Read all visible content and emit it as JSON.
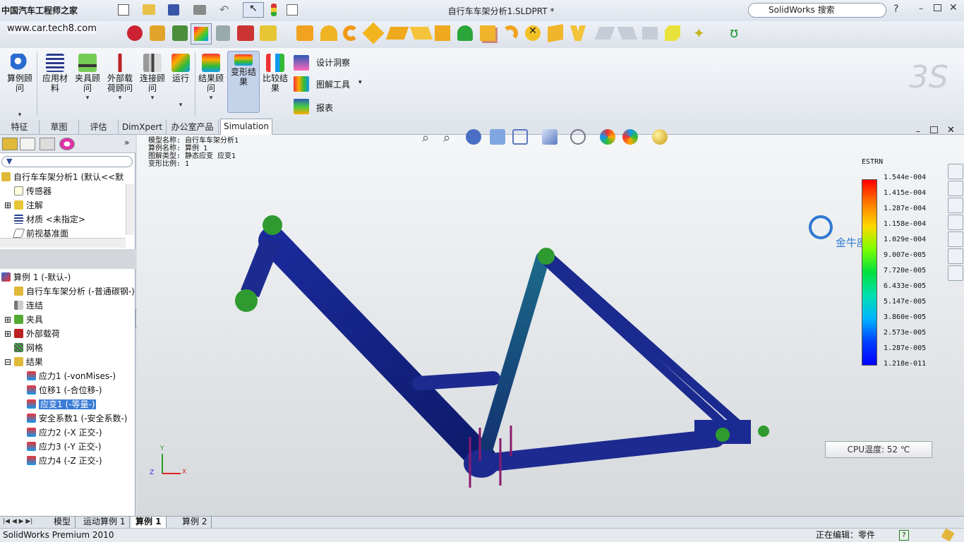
{
  "watermark": {
    "brand": "中国汽车工程师之家",
    "url": "www.car.tech8.com",
    "logo_text": "金牛座"
  },
  "titlebar": {
    "doc_title": "自行车车架分析1.SLDPRT *",
    "search_placeholder": "SolidWorks 搜索",
    "help": "?"
  },
  "ribbon": {
    "buttons": [
      {
        "label": "算例顾问"
      },
      {
        "label": "应用材料"
      },
      {
        "label": "夹具顾问"
      },
      {
        "label": "外部载荷顾问"
      },
      {
        "label": "连接顾问"
      },
      {
        "label": "运行"
      },
      {
        "label": "结果顾问"
      },
      {
        "label": "变形结果"
      },
      {
        "label": "比较结果"
      }
    ],
    "side_items": [
      {
        "label": "设计洞察"
      },
      {
        "label": "图解工具"
      },
      {
        "label": "报表"
      }
    ]
  },
  "tabs": [
    "特征",
    "草图",
    "评估",
    "DimXpert",
    "办公室产品",
    "Simulation"
  ],
  "active_tab": "Simulation",
  "feature_tree": {
    "root": "自行车车架分析1  (默认<<默",
    "items": [
      "传感器",
      "注解",
      "材质 <未指定>",
      "前视基准面"
    ]
  },
  "study_tree": {
    "root": "算例 1 (-默认-)",
    "items": [
      "自行车车架分析 (-普通碳钢-)",
      "连结",
      "夹具",
      "外部载荷",
      "网格",
      "结果"
    ],
    "results": [
      "应力1 (-vonMises-)",
      "位移1 (-合位移-)",
      "应变1 (-等量-)",
      "安全系数1 (-安全系数-)",
      "应力2 (-X 正交-)",
      "应力3 (-Y 正交-)",
      "应力4 (-Z 正交-)"
    ],
    "selected_result": "应变1 (-等量-)"
  },
  "plot_info": {
    "line1": "模型名称: 自行车车架分析1",
    "line2": "算例名称: 算例 1",
    "line3": "图解类型: 静态应变 应变1",
    "line4": "变形比例: 1"
  },
  "legend": {
    "title": "ESTRN",
    "ticks": [
      "1.544e-004",
      "1.415e-004",
      "1.287e-004",
      "1.158e-004",
      "1.029e-004",
      "9.007e-005",
      "7.720e-005",
      "6.433e-005",
      "5.147e-005",
      "3.860e-005",
      "2.573e-005",
      "1.287e-005",
      "1.218e-011"
    ]
  },
  "cpu_temp": "CPU温度: 52 ℃",
  "triad": {
    "x": "X",
    "y": "Y",
    "z": "Z"
  },
  "bottom_tabs": [
    "模型",
    "运动算例 1",
    "算例 1",
    "算例 2"
  ],
  "active_bottom_tab": "算例 1",
  "status": {
    "product": "SolidWorks Premium 2010",
    "editing": "正在编辑：零件",
    "help": "?"
  },
  "colors": {
    "ribbon_active": "#c5d3ea",
    "selection": "#3a7bd5",
    "frame_blue": "#1f2f8f",
    "load_arrow": "#8b1a6d",
    "fixture": "#2f9a2f"
  }
}
